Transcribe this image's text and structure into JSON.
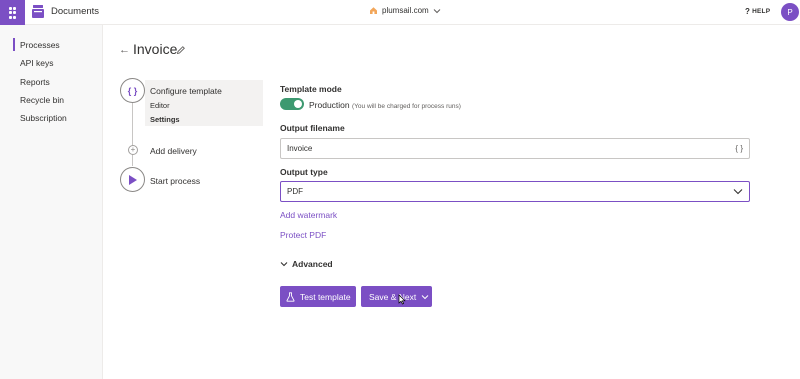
{
  "topbar": {
    "app_name": "Documents",
    "tenant": "plumsail.com",
    "help_label": "HELP",
    "avatar_initial": "P"
  },
  "sidebar": {
    "items": [
      {
        "label": "Processes",
        "active": true
      },
      {
        "label": "API keys",
        "active": false
      },
      {
        "label": "Reports",
        "active": false
      },
      {
        "label": "Recycle bin",
        "active": false
      },
      {
        "label": "Subscription",
        "active": false
      }
    ]
  },
  "page": {
    "title": "Invoice"
  },
  "steps": {
    "configure": {
      "label": "Configure template",
      "icon": "curly-braces-icon",
      "icon_glyph": "{ }",
      "sub": [
        "Editor",
        "Settings"
      ]
    },
    "delivery": {
      "label": "Add delivery",
      "icon_glyph": "+"
    },
    "start": {
      "label": "Start process",
      "icon": "play-icon"
    }
  },
  "form": {
    "template_mode_label": "Template mode",
    "toggle_on": true,
    "production_label": "Production",
    "production_hint": "(You will be charged for process runs)",
    "output_filename_label": "Output filename",
    "output_filename_value": "Invoice",
    "output_filename_icon": "{ }",
    "output_type_label": "Output type",
    "output_type_value": "PDF",
    "add_watermark": "Add watermark",
    "protect_pdf": "Protect PDF",
    "advanced_label": "Advanced"
  },
  "actions": {
    "test_template": "Test template",
    "save_next": "Save & Next"
  },
  "colors": {
    "accent": "#7b4fc4",
    "toggle_on": "#3d9970"
  }
}
